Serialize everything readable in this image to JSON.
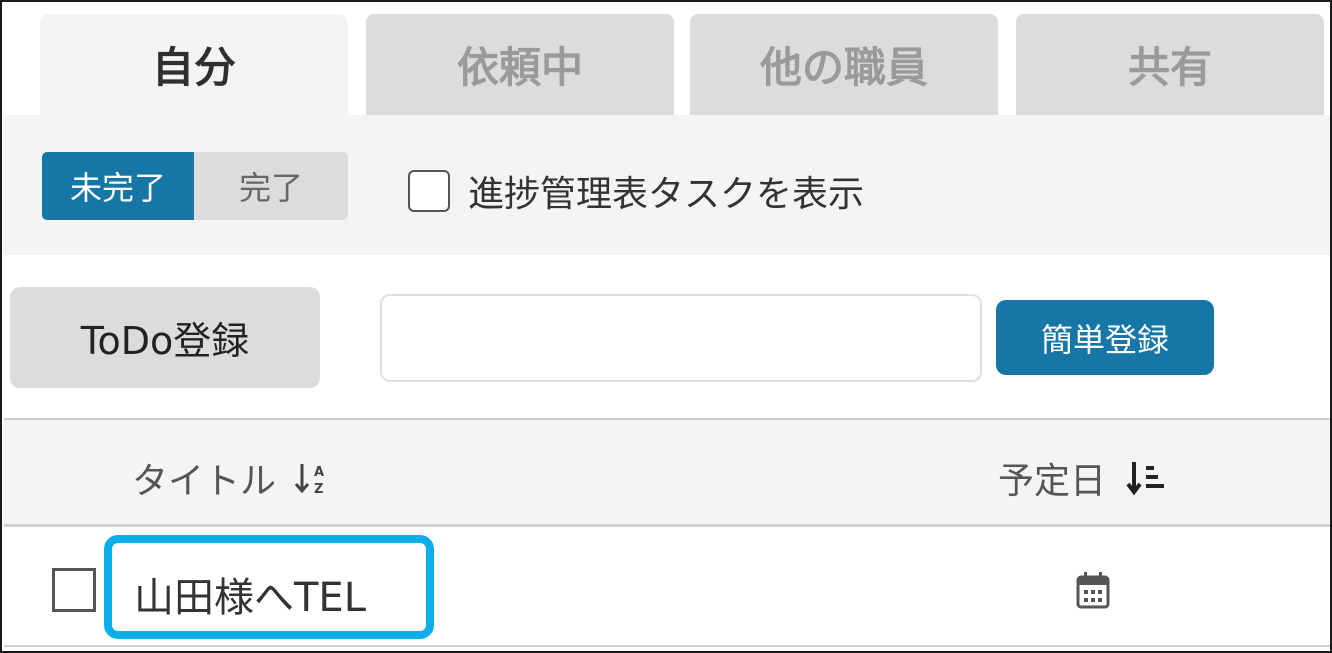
{
  "tabs": [
    {
      "label": "自分",
      "active": true
    },
    {
      "label": "依頼中",
      "active": false
    },
    {
      "label": "他の職員",
      "active": false
    },
    {
      "label": "共有",
      "active": false
    }
  ],
  "filter": {
    "segment": {
      "incomplete": "未完了",
      "complete": "完了",
      "selected": "未完了"
    },
    "progress_checkbox_label": "進捗管理表タスクを表示",
    "progress_checkbox_checked": false
  },
  "register": {
    "todo_button": "ToDo登録",
    "quick_input_value": "",
    "quick_button": "簡単登録"
  },
  "table": {
    "columns": {
      "title": "タイトル",
      "due_date": "予定日"
    },
    "title_sort_icon": "sort-alpha-down-icon",
    "date_sort_icon": "sort-amount-down-icon",
    "rows": [
      {
        "title": "山田様へTEL",
        "due_date": "",
        "checked": false,
        "date_icon": "calendar-icon"
      }
    ]
  },
  "colors": {
    "accent": "#1677a6",
    "highlight": "#09aeea",
    "tab_inactive": "#dcdcdc",
    "panel": "#f4f4f4"
  }
}
